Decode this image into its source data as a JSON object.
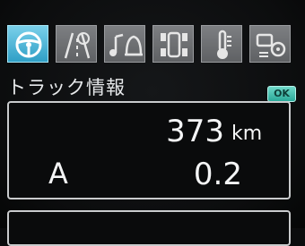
{
  "tabs": [
    {
      "icon": "steering-wheel-icon",
      "active": true
    },
    {
      "icon": "road-lane-icon",
      "active": false
    },
    {
      "icon": "music-bell-icon",
      "active": false
    },
    {
      "icon": "car-tire-icon",
      "active": false
    },
    {
      "icon": "thermometer-icon",
      "active": false
    },
    {
      "icon": "vehicle-settings-icon",
      "active": false
    }
  ],
  "section": {
    "title": "トラック情報",
    "ok_label": "OK"
  },
  "trip": {
    "distance_value": "373",
    "distance_unit": "km",
    "trip_label": "A",
    "trip_value": "0.2"
  },
  "colors": {
    "active_tab": "#2f9fc6",
    "ok_badge": "#2aa898",
    "text": "#f4f5f6"
  }
}
